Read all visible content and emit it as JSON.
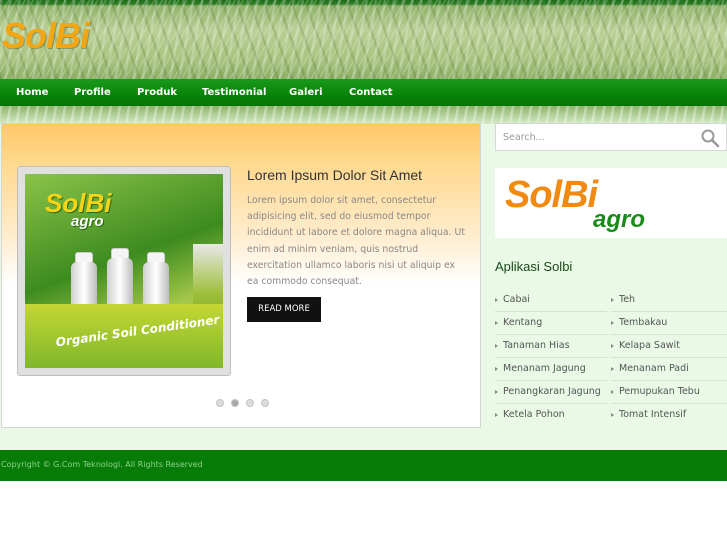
{
  "brand": {
    "logo_part1": "Sol",
    "logo_part2": "Bi"
  },
  "nav": [
    "Home",
    "Profile",
    "Produk",
    "Testimonial",
    "Galeri",
    "Contact"
  ],
  "slider": {
    "product_brand": "SolBi",
    "product_sub": "agro",
    "product_box_text": "Organic Soil Conditioner",
    "title": "Lorem Ipsum Dolor Sit Amet",
    "body": "Lorem ipsum dolor sit amet, consectetur adipisicing elit, sed do eiusmod tempor incididunt ut labore et dolore magna aliqua. Ut enim ad minim veniam, quis nostrud exercitation ullamco laboris nisi ut aliquip ex ea commodo consequat.",
    "button": "READ MORE",
    "dots": 4,
    "active_dot": 2
  },
  "search": {
    "placeholder": "Search..."
  },
  "sidebar_logo": {
    "part1": "SolBi",
    "part2": "agro"
  },
  "aplikasi": {
    "title": "Aplikasi Solbi",
    "left": [
      "Cabai",
      "Kentang",
      "Tanaman Hias",
      "Menanam Jagung",
      "Penangkaran Jagung",
      "Ketela Pohon"
    ],
    "right": [
      "Teh",
      "Tembakau",
      "Kelapa Sawit",
      "Menanam Padi",
      "Pemupukan Tebu",
      "Tomat Intensif"
    ]
  },
  "footer": {
    "text": "Copyright © G.Com Teknologi. All Rights Reserved"
  },
  "colors": {
    "nav_green": "#078307",
    "accent_orange": "#f3a614",
    "footer_green": "#067b06"
  }
}
